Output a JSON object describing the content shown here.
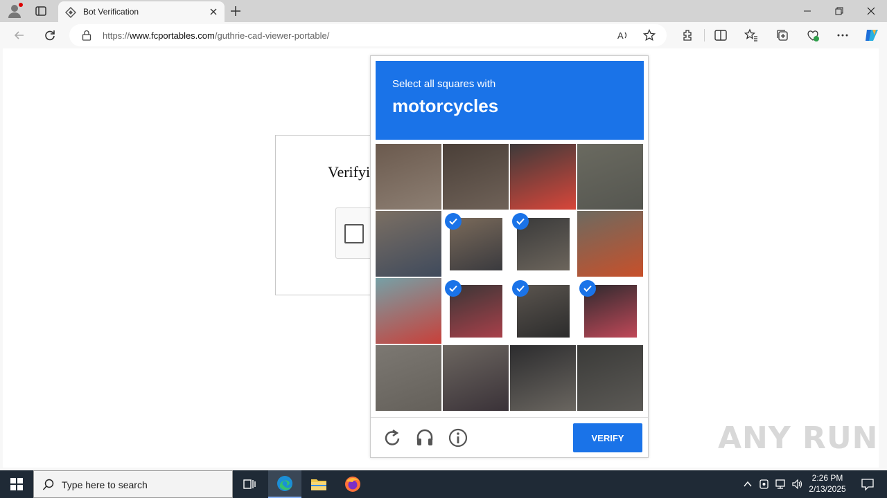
{
  "browser": {
    "tab_title": "Bot Verification",
    "url_prefix": "https://",
    "url_host": "www.fcportables.com",
    "url_path": "/guthrie-cad-viewer-portable/"
  },
  "page": {
    "heading_partial": "Verifyi"
  },
  "captcha": {
    "instruction": "Select all squares with",
    "target": "motorcycles",
    "verify_label": "VERIFY",
    "tiles": [
      {
        "row": 0,
        "col": 0,
        "selected": false,
        "colors": [
          "#6b5a4e",
          "#8d7f73"
        ]
      },
      {
        "row": 0,
        "col": 1,
        "selected": false,
        "colors": [
          "#4a3f38",
          "#6f6258"
        ]
      },
      {
        "row": 0,
        "col": 2,
        "selected": false,
        "colors": [
          "#3d3a3a",
          "#d8463a"
        ]
      },
      {
        "row": 0,
        "col": 3,
        "selected": false,
        "colors": [
          "#6a6a60",
          "#555650"
        ]
      },
      {
        "row": 1,
        "col": 0,
        "selected": false,
        "colors": [
          "#7b6f63",
          "#3f4a5c"
        ]
      },
      {
        "row": 1,
        "col": 1,
        "selected": true,
        "colors": [
          "#7a6a5a",
          "#3a3a3e"
        ]
      },
      {
        "row": 1,
        "col": 2,
        "selected": true,
        "colors": [
          "#3a3a3a",
          "#6c655c"
        ]
      },
      {
        "row": 1,
        "col": 3,
        "selected": false,
        "colors": [
          "#6d6a60",
          "#c8502a"
        ]
      },
      {
        "row": 2,
        "col": 0,
        "selected": false,
        "colors": [
          "#76a0a6",
          "#c8403a"
        ]
      },
      {
        "row": 2,
        "col": 1,
        "selected": true,
        "colors": [
          "#3a3636",
          "#a8404a"
        ]
      },
      {
        "row": 2,
        "col": 2,
        "selected": true,
        "colors": [
          "#5a544e",
          "#2c2c2c"
        ]
      },
      {
        "row": 2,
        "col": 3,
        "selected": true,
        "colors": [
          "#2e2a2e",
          "#c04858"
        ]
      },
      {
        "row": 3,
        "col": 0,
        "selected": false,
        "colors": [
          "#7c7872",
          "#64605a"
        ]
      },
      {
        "row": 3,
        "col": 1,
        "selected": false,
        "colors": [
          "#6c6660",
          "#3a3238"
        ]
      },
      {
        "row": 3,
        "col": 2,
        "selected": false,
        "colors": [
          "#2c2c2e",
          "#6a6660"
        ]
      },
      {
        "row": 3,
        "col": 3,
        "selected": false,
        "colors": [
          "#3a3a38",
          "#5c5a56"
        ]
      }
    ]
  },
  "watermark": "ANY RUN",
  "taskbar": {
    "search_placeholder": "Type here to search",
    "time": "2:26 PM",
    "date": "2/13/2025"
  },
  "colors": {
    "accent": "#1a73e8",
    "taskbar": "#1f2a36"
  }
}
